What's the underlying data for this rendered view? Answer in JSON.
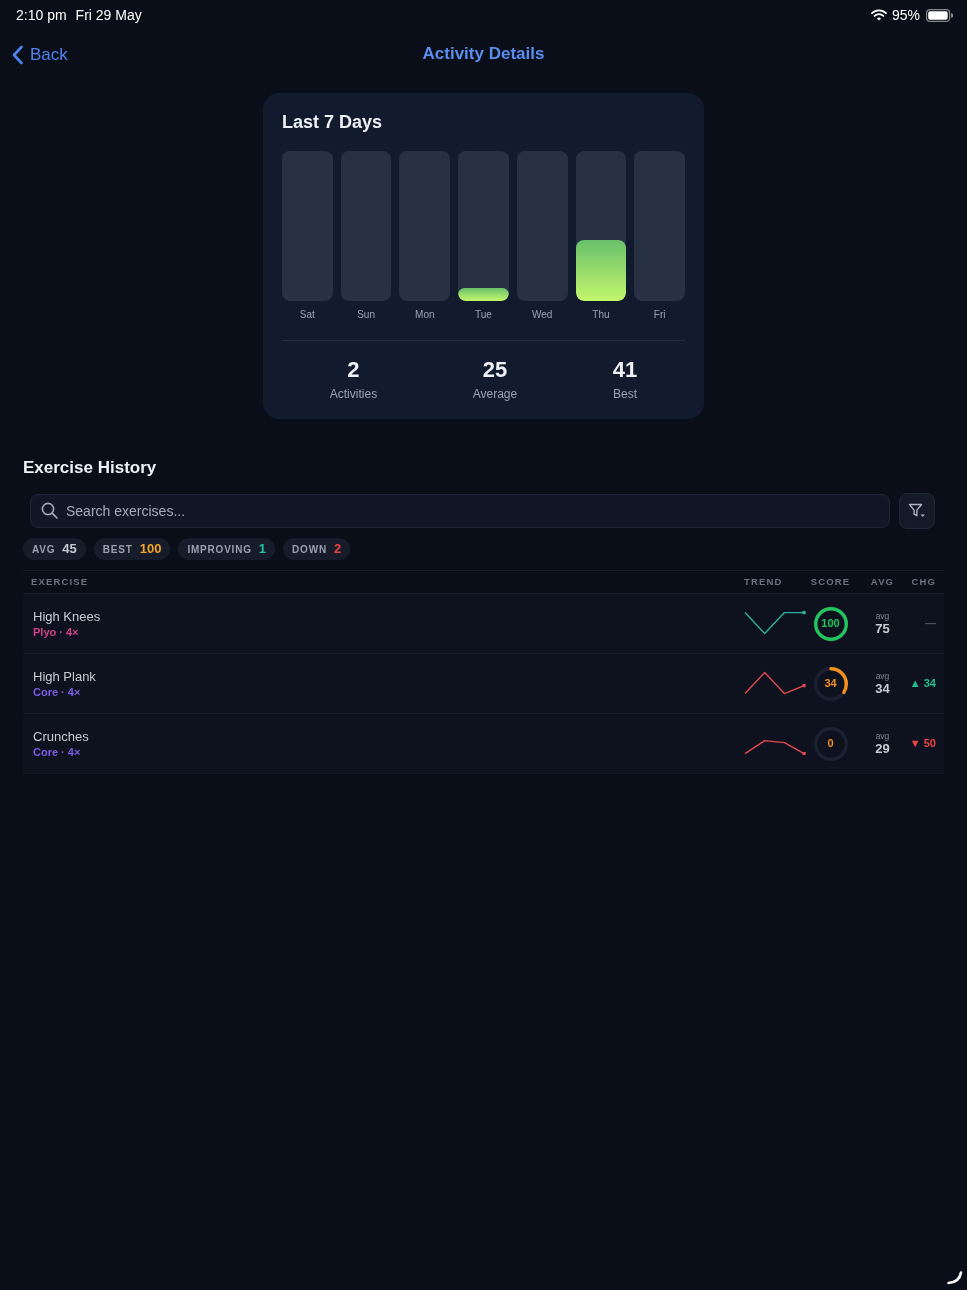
{
  "status_bar": {
    "time": "2:10 pm",
    "date": "Fri 29 May",
    "battery": "95%"
  },
  "nav": {
    "back": "Back",
    "title": "Activity Details"
  },
  "weekly_card": {
    "title": "Last 7 Days",
    "days": [
      {
        "label": "Sat"
      },
      {
        "label": "Sun"
      },
      {
        "label": "Mon"
      },
      {
        "label": "Tue",
        "level": 0.09
      },
      {
        "label": "Wed"
      },
      {
        "label": "Thu",
        "level": 0.41
      },
      {
        "label": "Fri"
      }
    ],
    "stats": [
      {
        "value": "2",
        "label": "Activities"
      },
      {
        "value": "25",
        "label": "Average"
      },
      {
        "value": "41",
        "label": "Best"
      }
    ]
  },
  "exercise_history": {
    "title": "Exercise History",
    "search": {
      "placeholder": "Search exercises..."
    },
    "pills": [
      {
        "label": "AVG",
        "value": "45",
        "color": "#c3c8d3"
      },
      {
        "label": "BEST",
        "value": "100",
        "color": "#f5a524"
      },
      {
        "label": "IMPROVING",
        "value": "1",
        "color": "#22c39a"
      },
      {
        "label": "DOWN",
        "value": "2",
        "color": "#ef4444"
      }
    ],
    "table": {
      "columns": [
        "EXERCISE",
        "TREND",
        "SCORE",
        "AVG",
        "CHG"
      ],
      "rows": [
        {
          "name": "High Knees",
          "tag": {
            "text": "Plyo · 4×",
            "color": "#d6418d"
          },
          "trend": {
            "color": "#2bb39b"
          },
          "score": {
            "value": "100",
            "level": 1,
            "color": "#22c55e"
          },
          "avg": {
            "label": "avg",
            "value": "75"
          },
          "change": {
            "kind": "none",
            "text": "—"
          }
        },
        {
          "name": "High Plank",
          "tag": {
            "text": "Core · 4×",
            "color": "#7c5ce6"
          },
          "trend": {
            "color": "#e04a4f"
          },
          "score": {
            "value": "34",
            "level": 0.34,
            "color": "#f5901e"
          },
          "avg": {
            "label": "avg",
            "value": "34"
          },
          "change": {
            "kind": "up",
            "text": "▲ 34"
          }
        },
        {
          "name": "Crunches",
          "tag": {
            "text": "Core · 4×",
            "color": "#7c5ce6"
          },
          "trend": {
            "color": "#e04a4f"
          },
          "score": {
            "value": "0",
            "color": "#f5901e"
          },
          "avg": {
            "label": "avg",
            "value": "29"
          },
          "change": {
            "kind": "down",
            "text": "▼ 50"
          }
        }
      ]
    }
  }
}
